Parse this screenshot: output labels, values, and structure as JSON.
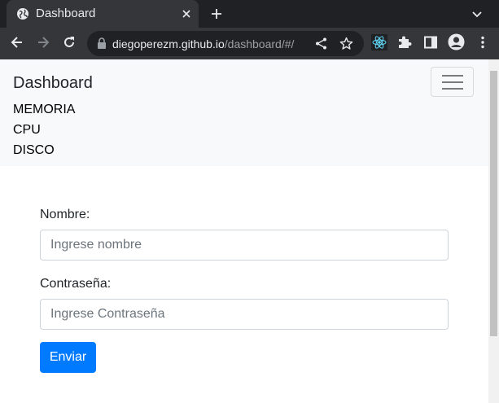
{
  "browser": {
    "tab_title": "Dashboard",
    "url_domain": "diegoperezm.github.io",
    "url_path": "/dashboard/#/",
    "icons": {
      "favicon": "globe-icon",
      "tab_close": "close-icon",
      "new_tab": "plus-icon",
      "tab_search": "chevron-down-icon",
      "back": "back-arrow-icon",
      "forward": "forward-arrow-icon",
      "reload": "reload-icon",
      "lock": "lock-icon",
      "share": "share-icon",
      "bookmark": "star-icon",
      "react_devtools": "react-icon",
      "extensions": "puzzle-icon",
      "side_panel": "side-panel-icon",
      "profile": "profile-avatar-icon",
      "menu": "kebab-menu-icon"
    },
    "colors": {
      "tabstrip_bg": "#202124",
      "toolbar_bg": "#35363a",
      "react_blue": "#61dafb"
    }
  },
  "navbar": {
    "brand": "Dashboard",
    "links": [
      "MEMORIA",
      "CPU",
      "DISCO"
    ],
    "toggler_icon": "hamburger-icon"
  },
  "form": {
    "name_label": "Nombre:",
    "name_placeholder": "Ingrese nombre",
    "password_label": "Contraseña:",
    "password_placeholder": "Ingrese Contraseña",
    "submit_label": "Enviar"
  },
  "colors": {
    "primary": "#007bff",
    "navbar_bg": "#f8f9fa"
  }
}
